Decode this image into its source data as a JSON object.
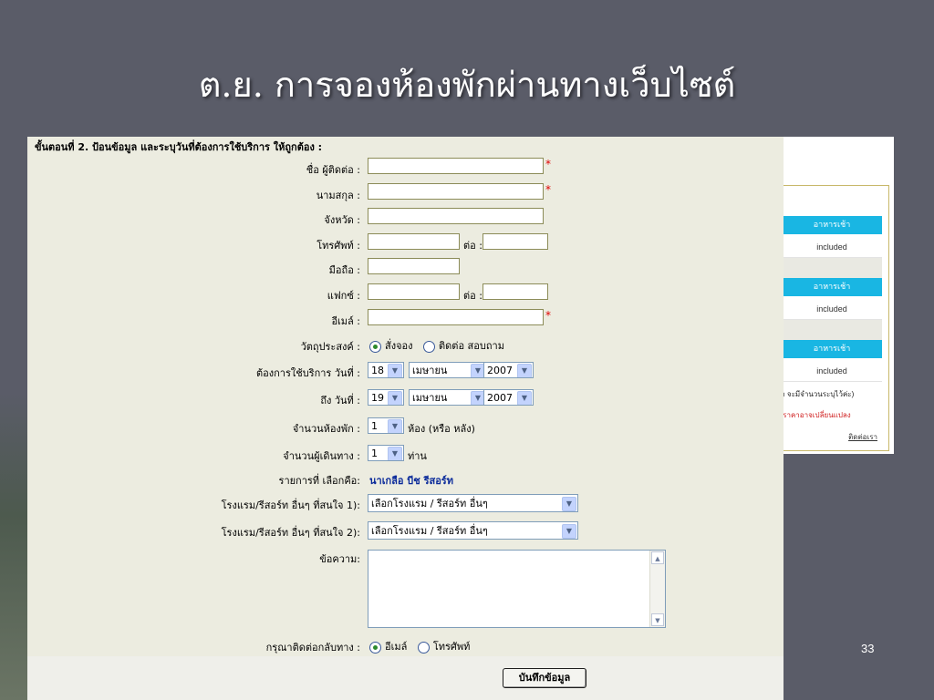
{
  "slide": {
    "title": "ต.ย. การจองห้องพักผ่านทางเว็บไซต์",
    "page_number": "33"
  },
  "background_table": {
    "column_header": "อาหารเช้า",
    "cell_value": "included",
    "note_1": "กกว่า จะมีจำนวนระบุไว้ค่ะ)",
    "note_2": "รอก ราคาอาจเปลี่ยนแปลง",
    "contact_link": "ติดต่อเรา",
    "colors": {
      "header": "#19b6e3",
      "note_2": "#d02020"
    }
  },
  "form": {
    "step_heading": "ขั้นตอนที่ 2. ป้อนข้อมูล และระบุวันที่ต้องการใช้บริการ ให้ถูกต้อง :",
    "required_mark": "*",
    "contact_name": {
      "label": "ชื่อ ผู้ติดต่อ :",
      "value": ""
    },
    "surname": {
      "label": "นามสกุล :",
      "value": ""
    },
    "province": {
      "label": "จังหวัด :",
      "value": ""
    },
    "phone": {
      "label": "โทรศัพท์ :",
      "value": "",
      "ext_label": "ต่อ :",
      "ext_value": ""
    },
    "mobile": {
      "label": "มือถือ :",
      "value": ""
    },
    "fax": {
      "label": "แฟกซ์ :",
      "value": "",
      "ext_label": "ต่อ :",
      "ext_value": ""
    },
    "email": {
      "label": "อีเมล์ :",
      "value": ""
    },
    "purpose": {
      "label": "วัตถุประสงค์ :",
      "options": [
        "สั่งจอง",
        "ติดต่อ สอบถาม"
      ],
      "selected": "สั่งจอง"
    },
    "checkin": {
      "label": "ต้องการใช้บริการ วันที่ :",
      "day": "18",
      "month": "เมษายน",
      "year": "2007"
    },
    "checkout": {
      "label": "ถึง วันที่ :",
      "day": "19",
      "month": "เมษายน",
      "year": "2007"
    },
    "rooms": {
      "label": "จำนวนห้องพัก :",
      "value": "1",
      "suffix": "ห้อง (หรือ หลัง)"
    },
    "guests": {
      "label": "จำนวนผู้เดินทาง :",
      "value": "1",
      "suffix": "ท่าน"
    },
    "selected_item": {
      "label": "รายการที่ เลือกคือ:",
      "value": "นาเกลือ บีช รีสอร์ท"
    },
    "other_hotel_1": {
      "label": "โรงแรม/รีสอร์ท อื่นๆ ที่สนใจ 1):",
      "value": "เลือกโรงแรม / รีสอร์ท อื่นๆ"
    },
    "other_hotel_2": {
      "label": "โรงแรม/รีสอร์ท อื่นๆ ที่สนใจ 2):",
      "value": "เลือกโรงแรม / รีสอร์ท อื่นๆ"
    },
    "message": {
      "label": "ข้อความ:",
      "value": ""
    },
    "contact_back": {
      "label": "กรุณาติดต่อกลับทาง :",
      "options": [
        "อีเมล์",
        "โทรศัพท์"
      ],
      "selected": "อีเมล์"
    },
    "save_label": "บันทึกข้อมูล"
  }
}
